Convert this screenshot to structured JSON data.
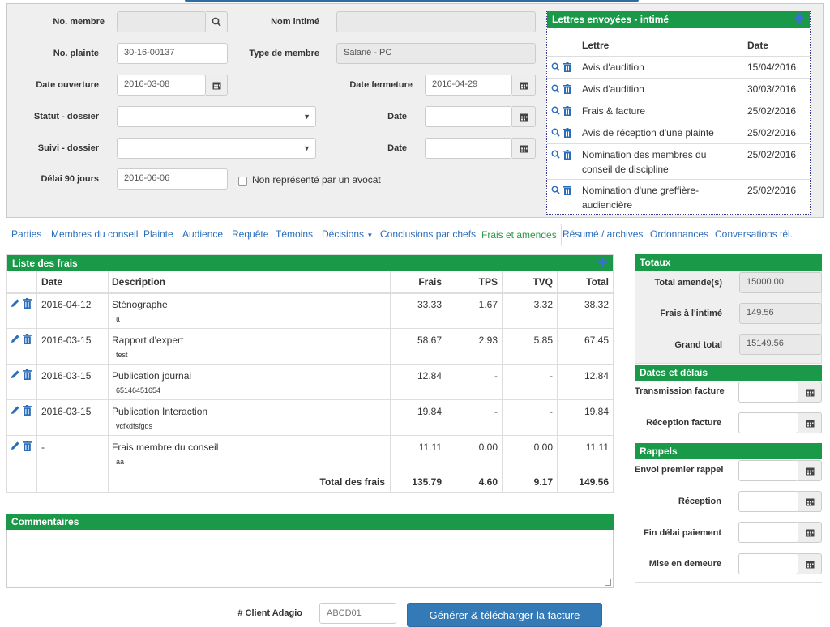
{
  "header": {
    "no_membre_label": "No. membre",
    "no_membre_value": "",
    "nom_intime_label": "Nom intimé",
    "nom_intime_value": "",
    "no_plainte_label": "No. plainte",
    "no_plainte_value": "30-16-00137",
    "type_membre_label": "Type de membre",
    "type_membre_value": "Salarié - PC",
    "date_ouverture_label": "Date ouverture",
    "date_ouverture_value": "2016-03-08",
    "date_fermeture_label": "Date fermeture",
    "date_fermeture_value": "2016-04-29",
    "statut_label": "Statut - dossier",
    "statut_value": "",
    "statut_date_label": "Date",
    "suivi_label": "Suivi - dossier",
    "suivi_value": "",
    "suivi_date_label": "Date",
    "delai_label": "Délai 90 jours",
    "delai_value": "2016-06-06",
    "avocat_label": "Non représenté par un avocat"
  },
  "letters": {
    "title": "Lettres envoyées - intimé",
    "col_lettre": "Lettre",
    "col_date": "Date",
    "rows": [
      {
        "lettre": "Avis d'audition",
        "date": "15/04/2016"
      },
      {
        "lettre": "Avis d'audition",
        "date": "30/03/2016"
      },
      {
        "lettre": "Frais & facture",
        "date": "25/02/2016"
      },
      {
        "lettre": "Avis de réception d'une plainte",
        "date": "25/02/2016"
      },
      {
        "lettre": "Nomination des membres du conseil de discipline",
        "date": "25/02/2016"
      },
      {
        "lettre": "Nomination d'une greffière-audiencière",
        "date": "25/02/2016"
      }
    ]
  },
  "tabs": [
    {
      "label": "Parties"
    },
    {
      "label": "Membres du conseil"
    },
    {
      "label": "Plainte"
    },
    {
      "label": "Audience"
    },
    {
      "label": "Requête"
    },
    {
      "label": "Témoins"
    },
    {
      "label": "Décisions"
    },
    {
      "label": "Conclusions par chefs"
    },
    {
      "label": "Frais et amendes"
    },
    {
      "label": "Résumé / archives"
    },
    {
      "label": "Ordonnances"
    },
    {
      "label": "Conversations tél."
    }
  ],
  "fees": {
    "title": "Liste des frais",
    "columns": {
      "date": "Date",
      "description": "Description",
      "frais": "Frais",
      "tps": "TPS",
      "tvq": "TVQ",
      "total": "Total"
    },
    "rows": [
      {
        "date": "2016-04-12",
        "description": "Sténographe",
        "note": "tt",
        "frais": "33.33",
        "tps": "1.67",
        "tvq": "3.32",
        "total": "38.32"
      },
      {
        "date": "2016-03-15",
        "description": "Rapport d'expert",
        "note": "test",
        "frais": "58.67",
        "tps": "2.93",
        "tvq": "5.85",
        "total": "67.45"
      },
      {
        "date": "2016-03-15",
        "description": "Publication journal",
        "note": "65146451654",
        "frais": "12.84",
        "tps": "-",
        "tvq": "-",
        "total": "12.84"
      },
      {
        "date": "2016-03-15",
        "description": "Publication Interaction",
        "note": "vcfxdfsfgds",
        "frais": "19.84",
        "tps": "-",
        "tvq": "-",
        "total": "19.84"
      },
      {
        "date": "-",
        "description": "Frais membre du conseil",
        "note": "aa",
        "frais": "11.11",
        "tps": "0.00",
        "tvq": "0.00",
        "total": "11.11"
      }
    ],
    "total_label": "Total des frais",
    "total_frais": "135.79",
    "total_tps": "4.60",
    "total_tvq": "9.17",
    "total_total": "149.56"
  },
  "comments": {
    "title": "Commentaires",
    "value": ""
  },
  "totaux": {
    "title": "Totaux",
    "amende_label": "Total amende(s)",
    "amende_value": "15000.00",
    "frais_label": "Frais à l'intimé",
    "frais_value": "149.56",
    "grand_label": "Grand total",
    "grand_value": "15149.56"
  },
  "dates": {
    "title": "Dates et délais",
    "transmission_label": "Transmission facture",
    "reception_label": "Réception facture"
  },
  "rappels": {
    "title": "Rappels",
    "envoi_label": "Envoi premier rappel",
    "reception_label": "Réception",
    "fin_label": "Fin délai paiement",
    "mise_label": "Mise en demeure"
  },
  "footer": {
    "client_label": "# Client Adagio",
    "client_placeholder": "ABCD01",
    "generate_label": "Générer & télécharger la facture"
  }
}
